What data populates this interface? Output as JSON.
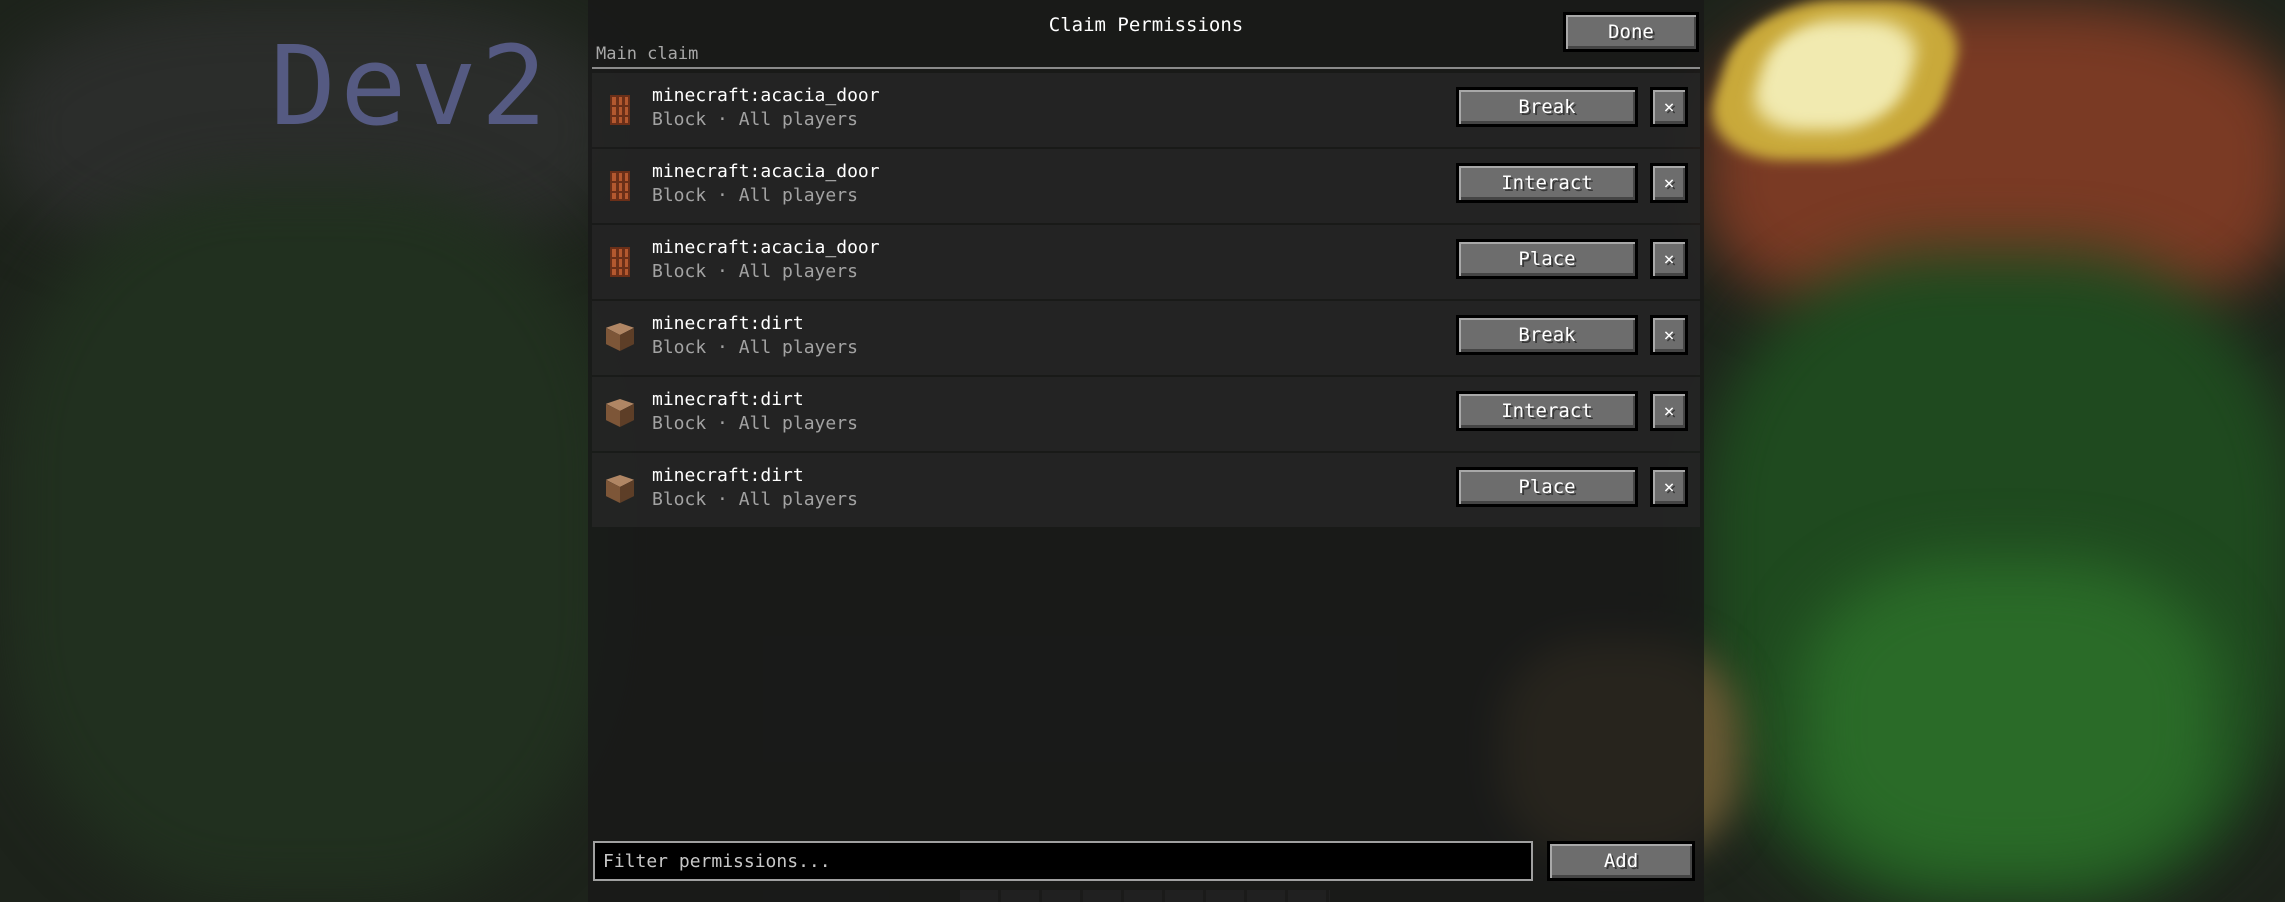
{
  "background": {
    "watermark": "Dev2"
  },
  "screen": {
    "title": "Claim Permissions",
    "done_label": "Done",
    "subtitle": "Main claim"
  },
  "rows": [
    {
      "name": "minecraft:acacia_door",
      "meta": "Block · All players",
      "icon": "acacia-door-icon",
      "action": "Break",
      "remove": "×"
    },
    {
      "name": "minecraft:acacia_door",
      "meta": "Block · All players",
      "icon": "acacia-door-icon",
      "action": "Interact",
      "remove": "×"
    },
    {
      "name": "minecraft:acacia_door",
      "meta": "Block · All players",
      "icon": "acacia-door-icon",
      "action": "Place",
      "remove": "×"
    },
    {
      "name": "minecraft:dirt",
      "meta": "Block · All players",
      "icon": "dirt-block-icon",
      "action": "Break",
      "remove": "×"
    },
    {
      "name": "minecraft:dirt",
      "meta": "Block · All players",
      "icon": "dirt-block-icon",
      "action": "Interact",
      "remove": "×"
    },
    {
      "name": "minecraft:dirt",
      "meta": "Block · All players",
      "icon": "dirt-block-icon",
      "action": "Place",
      "remove": "×"
    }
  ],
  "footer": {
    "filter_placeholder": "Filter permissions...",
    "add_label": "Add"
  },
  "colors": {
    "button_face": "#6d6d6d",
    "panel_bg": "#181818",
    "text_primary": "#ffffff",
    "text_secondary": "#a3a3a3"
  }
}
